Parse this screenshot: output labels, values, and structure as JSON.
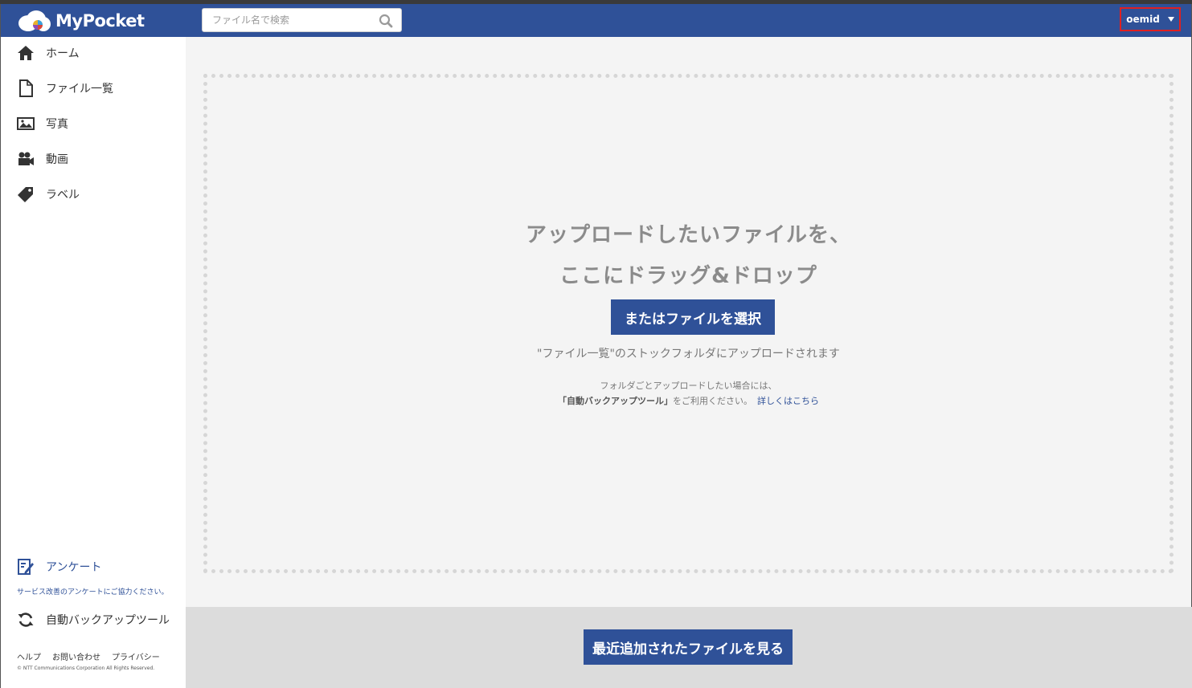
{
  "header": {
    "logo_text": "MyPocket",
    "search_placeholder": "ファイル名で検索",
    "user_name": "oemid"
  },
  "sidebar": {
    "items": [
      {
        "label": "ホーム",
        "icon": "home-icon"
      },
      {
        "label": "ファイル一覧",
        "icon": "file-icon"
      },
      {
        "label": "写真",
        "icon": "photo-icon"
      },
      {
        "label": "動画",
        "icon": "video-camera-icon"
      },
      {
        "label": "ラベル",
        "icon": "tag-icon"
      }
    ],
    "survey": {
      "label": "アンケート",
      "note": "サービス改善のアンケートにご協力ください。"
    },
    "backup_tool": {
      "label": "自動バックアップツール"
    },
    "footer_links": [
      "ヘルプ",
      "お問い合わせ",
      "プライバシー"
    ],
    "copyright": "© NTT Communications Corporation All Rights Reserved."
  },
  "dropzone": {
    "title_line1": "アップロードしたいファイルを、",
    "title_line2": "ここにドラッグ&ドロップ",
    "select_button": "またはファイルを選択",
    "note": "\"ファイル一覧\"のストックフォルダにアップロードされます",
    "folder_note_line1": "フォルダごとアップロードしたい場合には、",
    "folder_note_tool": "「自動バックアップツール」",
    "folder_note_suffix": "をご利用ください。",
    "details_link": "詳しくはこちら"
  },
  "bottom": {
    "recent_button": "最近追加されたファイルを見る"
  },
  "colors": {
    "brand": "#2f5198",
    "highlight": "#e02020"
  }
}
